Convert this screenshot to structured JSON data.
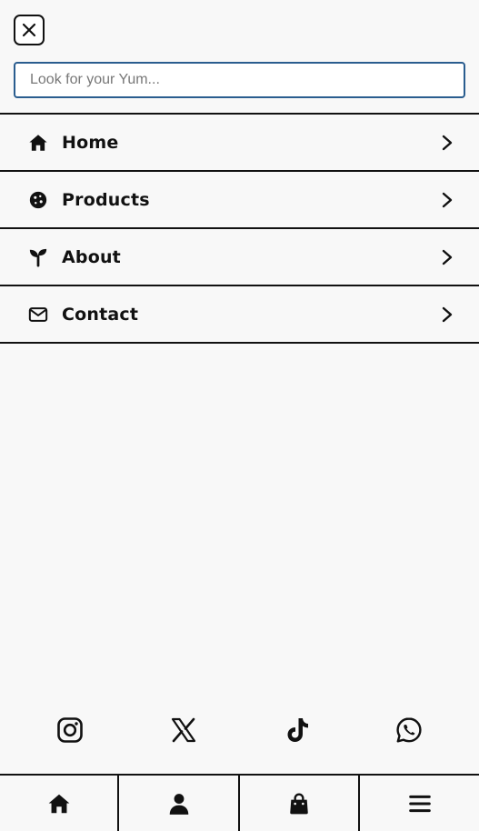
{
  "search": {
    "placeholder": "Look for your Yum..."
  },
  "menu": {
    "items": [
      {
        "label": "Home",
        "icon": "home-icon"
      },
      {
        "label": "Products",
        "icon": "cookie-icon"
      },
      {
        "label": "About",
        "icon": "sprout-icon"
      },
      {
        "label": "Contact",
        "icon": "envelope-icon"
      }
    ]
  },
  "socials": [
    "instagram-icon",
    "x-icon",
    "tiktok-icon",
    "whatsapp-icon"
  ],
  "bottom_nav": [
    "home-icon",
    "user-icon",
    "shopping-bag-icon",
    "hamburger-menu-icon"
  ],
  "colors": {
    "background": "#f8f8f8",
    "foreground": "#111111",
    "input_border": "#2a5d8f"
  }
}
